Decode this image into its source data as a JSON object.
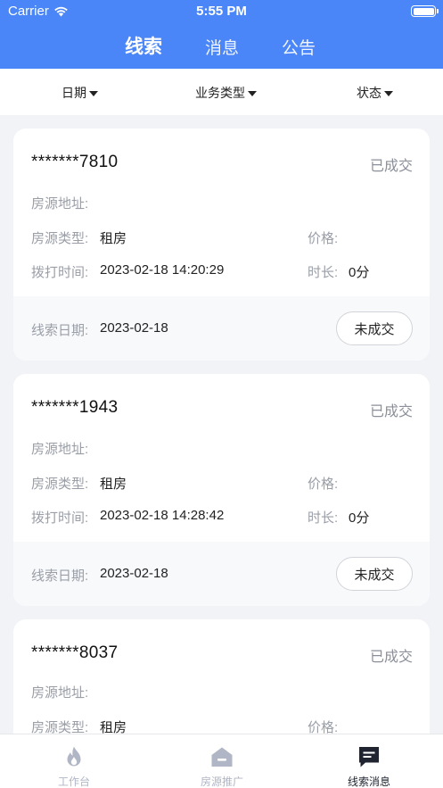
{
  "status_bar": {
    "carrier": "Carrier",
    "time": "5:55 PM"
  },
  "top_tabs": [
    {
      "label": "线索",
      "active": true
    },
    {
      "label": "消息",
      "active": false
    },
    {
      "label": "公告",
      "active": false
    }
  ],
  "filters": [
    {
      "label": "日期"
    },
    {
      "label": "业务类型"
    },
    {
      "label": "状态"
    }
  ],
  "card_labels": {
    "address": "房源地址:",
    "type": "房源类型:",
    "price": "价格:",
    "call_time": "拨打时间:",
    "duration": "时长:",
    "lead_date": "线索日期:"
  },
  "cards": [
    {
      "phone": "*******7810",
      "status": "已成交",
      "address": "",
      "type": "租房",
      "price": "",
      "call_time": "2023-02-18 14:20:29",
      "duration": "0分",
      "lead_date": "2023-02-18",
      "action": "未成交"
    },
    {
      "phone": "*******1943",
      "status": "已成交",
      "address": "",
      "type": "租房",
      "price": "",
      "call_time": "2023-02-18 14:28:42",
      "duration": "0分",
      "lead_date": "2023-02-18",
      "action": "未成交"
    },
    {
      "phone": "*******8037",
      "status": "已成交",
      "address": "",
      "type": "租房",
      "price": ""
    }
  ],
  "tabbar": [
    {
      "label": "工作台",
      "icon": "flame-icon",
      "active": false
    },
    {
      "label": "房源推广",
      "icon": "house-icon",
      "active": false
    },
    {
      "label": "线索消息",
      "icon": "message-icon",
      "active": true
    }
  ],
  "colors": {
    "header": "#4a86f7",
    "background": "#f2f3f7",
    "inactive_tab_icon": "#b0b6c6",
    "active_tab_icon": "#1f2430"
  }
}
